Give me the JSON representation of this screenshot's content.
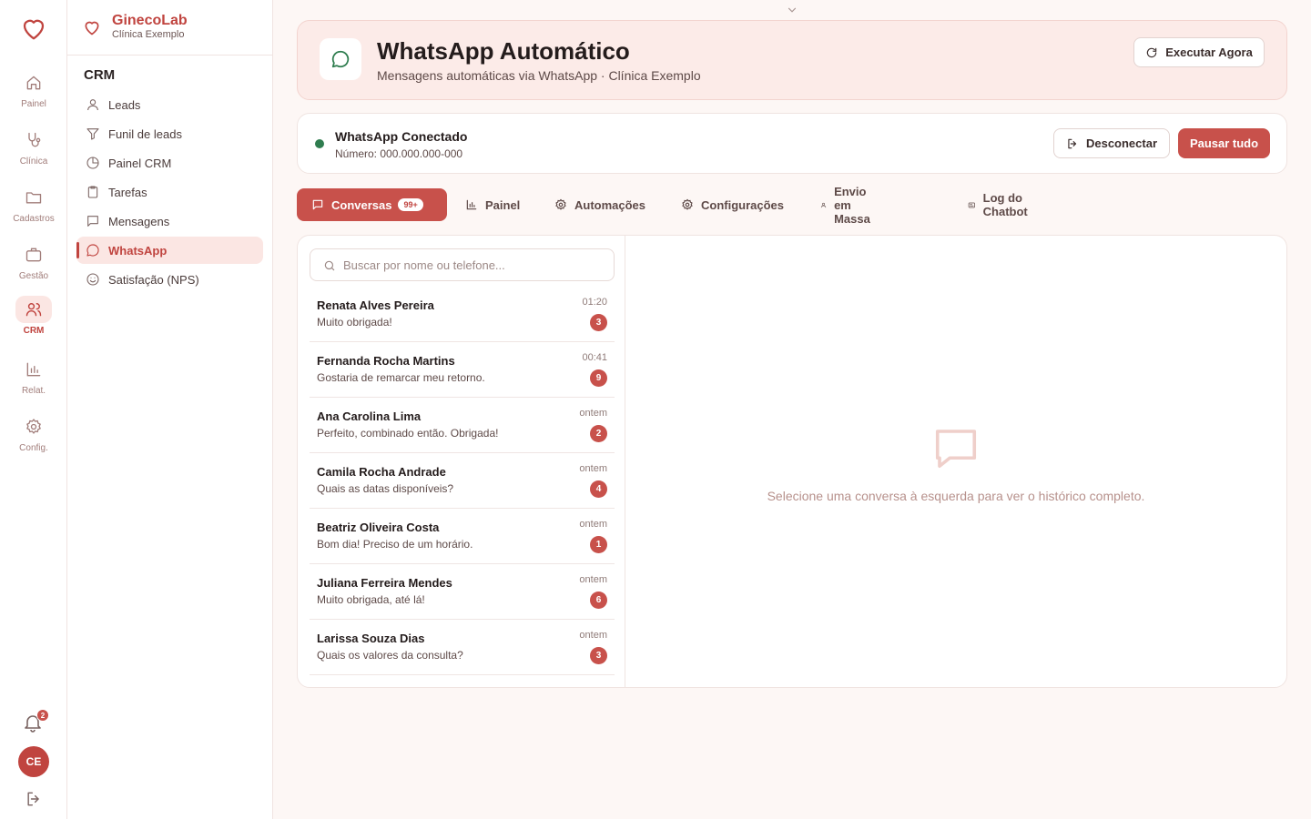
{
  "brand": {
    "name": "GinecoLab",
    "clinic": "Clínica Exemplo",
    "accent": "#c0443f",
    "success": "#2f7d4f"
  },
  "rail": {
    "items": [
      {
        "label": "Painel",
        "icon": "home-icon"
      },
      {
        "label": "Clínica",
        "icon": "stethoscope-icon"
      },
      {
        "label": "Cadastros",
        "icon": "folder-icon"
      },
      {
        "label": "Gestão",
        "icon": "briefcase-icon"
      },
      {
        "label": "CRM",
        "icon": "users-icon",
        "active": true
      },
      {
        "label": "Relat.",
        "icon": "bar-chart-icon"
      },
      {
        "label": "Config.",
        "icon": "gear-icon"
      }
    ],
    "notifications_count": "2",
    "avatar_initials": "CE"
  },
  "sidebar": {
    "section": "CRM",
    "items": [
      {
        "label": "Leads",
        "icon": "user-icon"
      },
      {
        "label": "Funil de leads",
        "icon": "funnel-icon"
      },
      {
        "label": "Painel CRM",
        "icon": "pie-chart-icon"
      },
      {
        "label": "Tarefas",
        "icon": "clipboard-icon"
      },
      {
        "label": "Mensagens",
        "icon": "message-icon"
      },
      {
        "label": "WhatsApp",
        "icon": "whatsapp-icon",
        "active": true
      },
      {
        "label": "Satisfação (NPS)",
        "icon": "smile-icon"
      }
    ]
  },
  "header": {
    "title": "WhatsApp Automático",
    "subtitle": "Mensagens automáticas via WhatsApp · Clínica Exemplo",
    "run_now": "Executar Agora"
  },
  "status": {
    "title": "WhatsApp Conectado",
    "number": "Número: 000.000.000-000",
    "disconnect": "Desconectar",
    "pause_all": "Pausar tudo"
  },
  "tabs": [
    {
      "label": "Conversas",
      "badge": "99+",
      "active": true,
      "icon": "chat-icon"
    },
    {
      "label": "Painel",
      "icon": "bar-chart-icon"
    },
    {
      "label": "Automações",
      "icon": "gear-icon"
    },
    {
      "label": "Configurações",
      "icon": "gear-icon"
    },
    {
      "label": "Envio em Massa",
      "icon": "user-icon"
    },
    {
      "label": "Log do Chatbot",
      "icon": "log-icon"
    }
  ],
  "search": {
    "placeholder": "Buscar por nome ou telefone..."
  },
  "conversations": [
    {
      "name": "Renata Alves Pereira",
      "message": "Muito obrigada!",
      "time": "01:20",
      "unread": "3"
    },
    {
      "name": "Fernanda Rocha Martins",
      "message": "Gostaria de remarcar meu retorno.",
      "time": "00:41",
      "unread": "9"
    },
    {
      "name": "Ana Carolina Lima",
      "message": "Perfeito, combinado então. Obrigada!",
      "time": "ontem",
      "unread": "2"
    },
    {
      "name": "Camila Rocha Andrade",
      "message": "Quais as datas disponíveis?",
      "time": "ontem",
      "unread": "4"
    },
    {
      "name": "Beatriz Oliveira Costa",
      "message": "Bom dia! Preciso de um horário.",
      "time": "ontem",
      "unread": "1"
    },
    {
      "name": "Juliana Ferreira Mendes",
      "message": "Muito obrigada, até lá!",
      "time": "ontem",
      "unread": "6"
    },
    {
      "name": "Larissa Souza Dias",
      "message": "Quais os valores da consulta?",
      "time": "ontem",
      "unread": "3"
    }
  ],
  "empty_state": {
    "text": "Selecione uma conversa à esquerda para ver o histórico completo."
  }
}
